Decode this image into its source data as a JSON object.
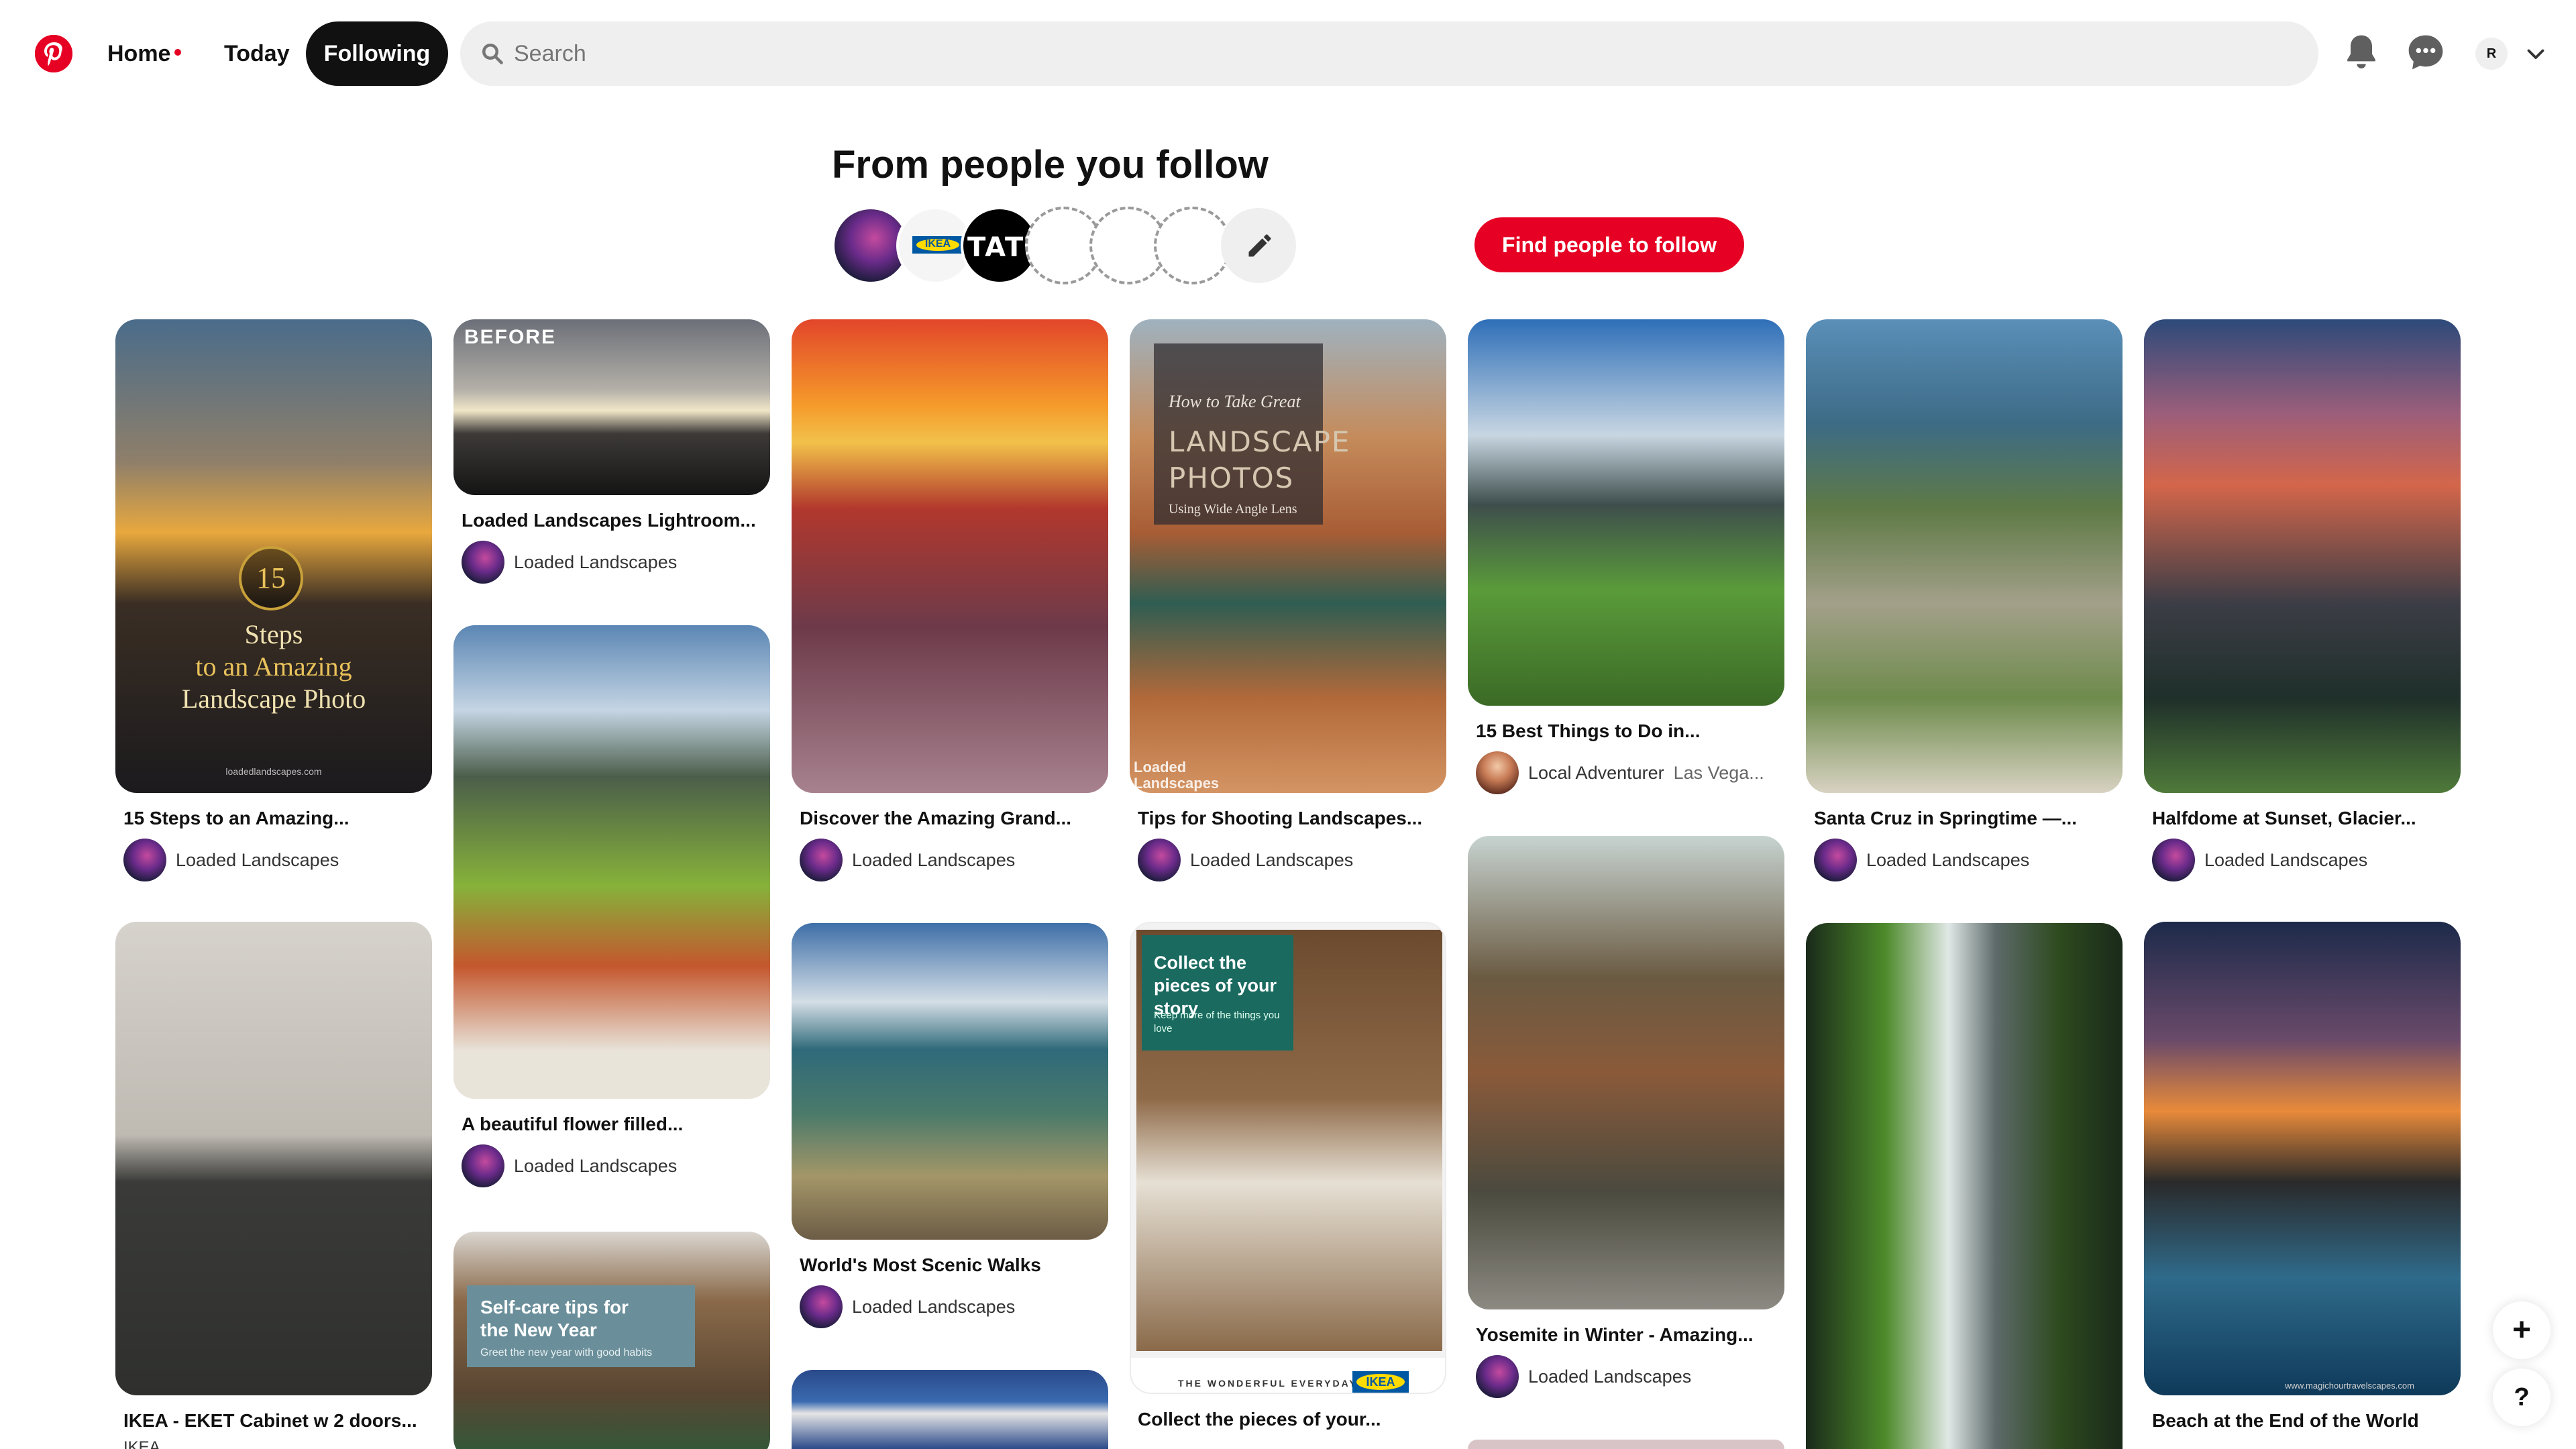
{
  "header": {
    "logo_icon": "pinterest-logo",
    "nav": {
      "home": "Home",
      "today": "Today",
      "following": "Following"
    },
    "search_placeholder": "Search",
    "notifications_icon": "bell-icon",
    "messages_icon": "chat-bubble-icon",
    "profile_initial": "R",
    "account_menu_icon": "chevron-down-icon"
  },
  "following_section": {
    "title": "From people you follow",
    "avatar_labels": {
      "ikea": "IKEA",
      "tattoo": "TATT"
    },
    "edit_icon": "pencil-icon",
    "find_button": "Find people to follow"
  },
  "pins": [
    {
      "title": "15 Steps to an Amazing...",
      "owner": "Loaded Landscapes",
      "overlay": {
        "number": "15",
        "line1": "Steps",
        "line2": "to an Amazing",
        "line3": "Landscape Photo",
        "url": "loadedlandscapes.com"
      }
    },
    {
      "title": "Loaded Landscapes Lightroom...",
      "owner": "Loaded Landscapes",
      "overlay": {
        "label": "BEFORE"
      }
    },
    {
      "title": "A beautiful flower filled...",
      "owner": "Loaded Landscapes"
    },
    {
      "title": "Discover the Amazing Grand...",
      "owner": "Loaded Landscapes"
    },
    {
      "title": "World's Most Scenic Walks",
      "owner": "Loaded Landscapes"
    },
    {
      "title": "Tips for Shooting Landscapes...",
      "owner": "Loaded Landscapes",
      "overlay": {
        "line1": "How to Take Great",
        "line2": "LANDSCAPE PHOTOS",
        "line3": "Using Wide Angle Lens",
        "footer": "Loaded Landscapes"
      }
    },
    {
      "title": "Collect the pieces of your...",
      "owner": "IKEA",
      "overlay": {
        "heading": "Collect the pieces of your story",
        "sub": "Keep more of the things you love",
        "footer": "THE WONDERFUL EVERYDAY",
        "brand": "IKEA"
      }
    },
    {
      "title": "15 Best Things to Do in...",
      "owner": "Local Adventurer",
      "owner_sub": "Las Vega..."
    },
    {
      "title": "Yosemite in Winter - Amazing...",
      "owner": "Loaded Landscapes"
    },
    {
      "title": "Santa Cruz in Springtime —...",
      "owner": "Loaded Landscapes"
    },
    {
      "title": "Halfdome at Sunset, Glacier...",
      "owner": "Loaded Landscapes"
    },
    {
      "title": "Beach at the End of the World",
      "owner": "Loaded Landscapes",
      "overlay": {
        "watermark": "www.magichourtravelscapes.com"
      }
    },
    {
      "title": "IKEA - EKET Cabinet w 2 doors...",
      "owner": "IKEA"
    },
    {
      "title": "",
      "owner": "",
      "overlay": {
        "heading": "Self-care tips for the New Year",
        "sub": "Greet the new year with good habits"
      }
    }
  ],
  "floating": {
    "add": "+",
    "help": "?"
  },
  "colors": {
    "brand_red": "#e60023",
    "nav_active_bg": "#111111",
    "search_bg": "#efefef"
  }
}
